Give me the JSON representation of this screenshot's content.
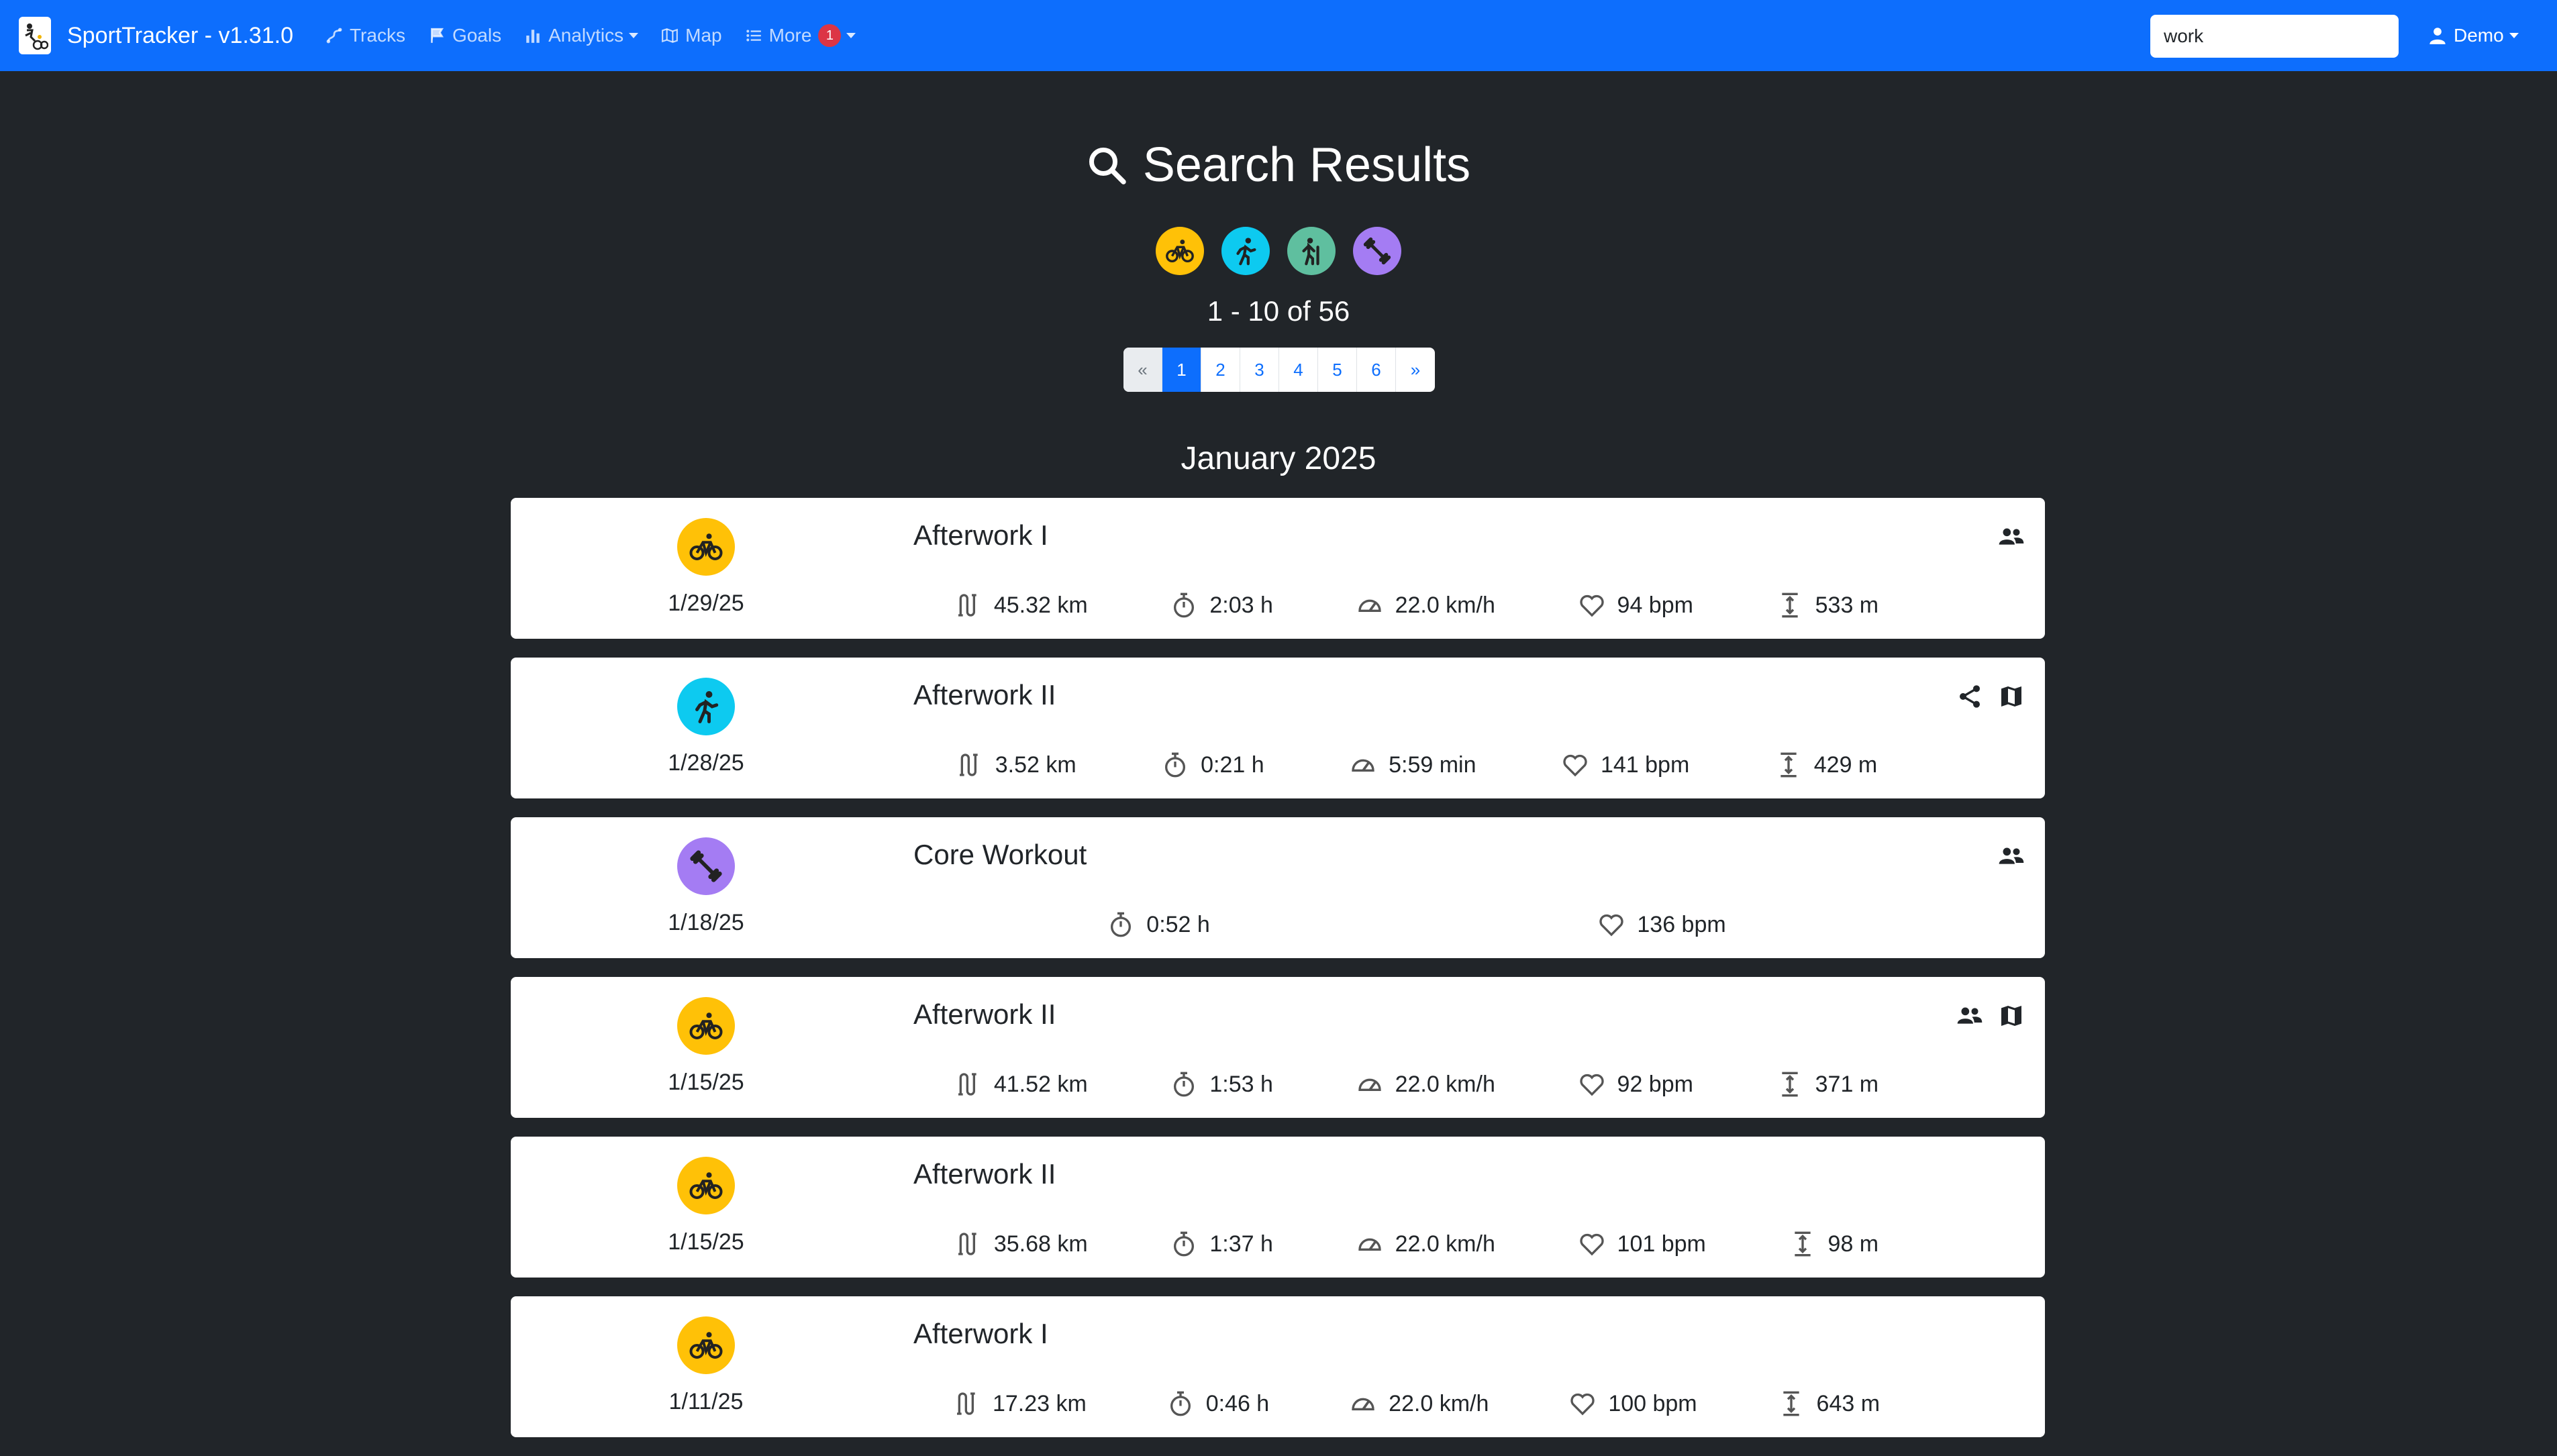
{
  "app": {
    "title": "SportTracker - v1.31.0"
  },
  "nav": {
    "tracks": "Tracks",
    "goals": "Goals",
    "analytics": "Analytics",
    "map": "Map",
    "more": "More",
    "more_badge": "1"
  },
  "search": {
    "value": "work"
  },
  "user": {
    "label": "Demo"
  },
  "results": {
    "title": "Search Results",
    "count": "1 - 10 of 56",
    "filters": [
      {
        "icon": "bike-icon",
        "color": "#ffc107"
      },
      {
        "icon": "run-icon",
        "color": "#0dcaf0"
      },
      {
        "icon": "hike-icon",
        "color": "#5fbf9f"
      },
      {
        "icon": "dumbbell-icon",
        "color": "#a47cf3"
      }
    ]
  },
  "pagination": {
    "prev": "«",
    "pages": [
      "1",
      "2",
      "3",
      "4",
      "5",
      "6"
    ],
    "next": "»",
    "active": "1"
  },
  "month": "January 2025",
  "colors": {
    "navbar": "#0d6efd",
    "background": "#212529",
    "cycling": "#ffc107",
    "running": "#0dcaf0",
    "workout": "#a47cf3"
  },
  "tracks": [
    {
      "sport": "cycling",
      "date": "1/29/25",
      "title": "Afterwork I",
      "distance": "45.32 km",
      "duration": "2:03 h",
      "speed": "22.0 km/h",
      "heart_rate": "94 bpm",
      "elevation": "533 m",
      "actions": [
        "group-icon"
      ]
    },
    {
      "sport": "running",
      "date": "1/28/25",
      "title": "Afterwork II",
      "distance": "3.52 km",
      "duration": "0:21 h",
      "speed": "5:59 min",
      "heart_rate": "141 bpm",
      "elevation": "429 m",
      "actions": [
        "share-icon",
        "map-icon"
      ]
    },
    {
      "sport": "workout",
      "date": "1/18/25",
      "title": "Core Workout",
      "duration": "0:52 h",
      "heart_rate": "136 bpm",
      "actions": [
        "group-icon"
      ]
    },
    {
      "sport": "cycling",
      "date": "1/15/25",
      "title": "Afterwork II",
      "distance": "41.52 km",
      "duration": "1:53 h",
      "speed": "22.0 km/h",
      "heart_rate": "92 bpm",
      "elevation": "371 m",
      "actions": [
        "group-icon",
        "map-icon"
      ]
    },
    {
      "sport": "cycling",
      "date": "1/15/25",
      "title": "Afterwork II",
      "distance": "35.68 km",
      "duration": "1:37 h",
      "speed": "22.0 km/h",
      "heart_rate": "101 bpm",
      "elevation": "98 m",
      "actions": []
    },
    {
      "sport": "cycling",
      "date": "1/11/25",
      "title": "Afterwork I",
      "distance": "17.23 km",
      "duration": "0:46 h",
      "speed": "22.0 km/h",
      "heart_rate": "100 bpm",
      "elevation": "643 m",
      "actions": []
    }
  ]
}
